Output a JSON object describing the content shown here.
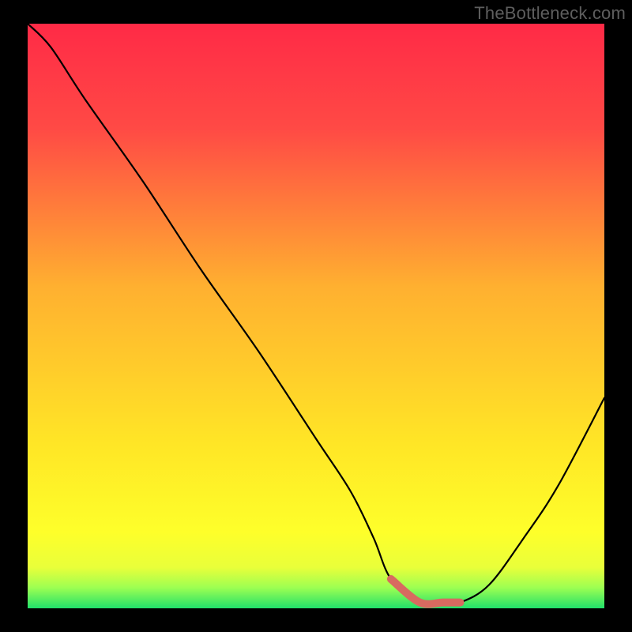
{
  "watermark": "TheBottleneck.com",
  "colors": {
    "frame": "#000000",
    "curve": "#000000",
    "highlight": "#d86a60",
    "gradient_stops": [
      {
        "offset": 0.0,
        "color": "#ff2a46"
      },
      {
        "offset": 0.18,
        "color": "#ff4a45"
      },
      {
        "offset": 0.45,
        "color": "#ffb030"
      },
      {
        "offset": 0.72,
        "color": "#ffe626"
      },
      {
        "offset": 0.87,
        "color": "#feff2a"
      },
      {
        "offset": 0.93,
        "color": "#e9ff3a"
      },
      {
        "offset": 0.965,
        "color": "#9cff52"
      },
      {
        "offset": 1.0,
        "color": "#21e06a"
      }
    ]
  },
  "chart_data": {
    "type": "line",
    "title": "",
    "xlabel": "",
    "ylabel": "",
    "xlim": [
      0,
      100
    ],
    "ylim": [
      0,
      100
    ],
    "series": [
      {
        "name": "bottleneck-curve",
        "x": [
          0,
          4,
          10,
          20,
          30,
          40,
          50,
          56,
          60,
          63,
          68,
          72,
          75,
          80,
          86,
          92,
          100
        ],
        "y": [
          100,
          96,
          87,
          73,
          58,
          44,
          29,
          20,
          12,
          5,
          1,
          1,
          1,
          4,
          12,
          21,
          36
        ]
      }
    ],
    "highlight_segment": {
      "series": "bottleneck-curve",
      "x_start": 63,
      "x_end": 75,
      "style": "thick"
    },
    "gradient": "vertical red→yellow→green (high=bad, low=good)",
    "grid": false,
    "legend": false
  }
}
